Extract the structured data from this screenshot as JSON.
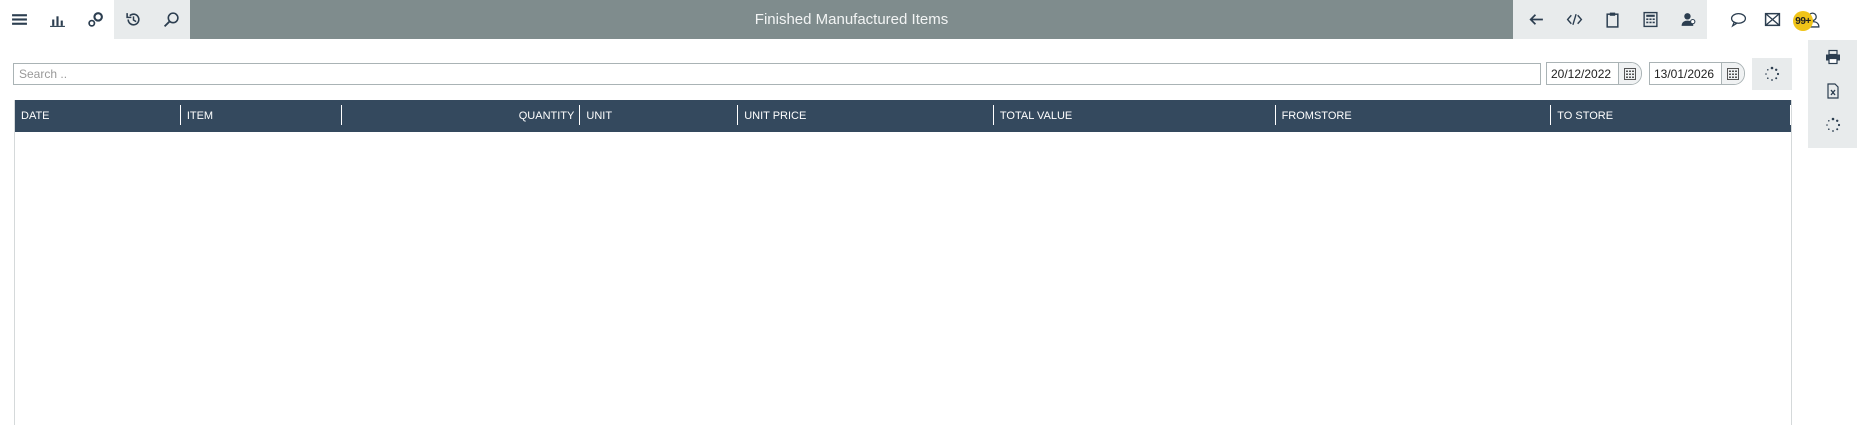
{
  "window": {
    "title": "Finished Manufactured Items"
  },
  "toolbar_left": [
    {
      "name": "menu-icon"
    },
    {
      "name": "bar-chart-icon"
    },
    {
      "name": "gears-icon"
    },
    {
      "name": "history-icon"
    },
    {
      "name": "search-icon"
    }
  ],
  "toolbar_mid": [
    {
      "name": "back-arrow-icon"
    },
    {
      "name": "code-icon"
    },
    {
      "name": "clipboard-icon"
    },
    {
      "name": "calculator-icon"
    },
    {
      "name": "users-icon"
    }
  ],
  "toolbar_right": [
    {
      "name": "chat-icon"
    },
    {
      "name": "mail-icon"
    },
    {
      "name": "user-icon"
    }
  ],
  "notifications": {
    "count": "99+"
  },
  "search": {
    "placeholder": "Search ..",
    "value": ""
  },
  "filters": {
    "date_from": "20/12/2022",
    "date_to": "13/01/2026"
  },
  "table": {
    "columns": [
      "DATE",
      "ITEM",
      "QUANTITY",
      "UNIT",
      "UNIT PRICE",
      "TOTAL VALUE",
      "FROMSTORE",
      "TO STORE"
    ],
    "rows": []
  },
  "side_tools": [
    {
      "name": "print-icon"
    },
    {
      "name": "excel-export-icon"
    },
    {
      "name": "refresh-icon"
    }
  ],
  "colors": {
    "header_bg": "#34495e",
    "title_bar": "#7f8c8d",
    "badge": "#f0c419"
  }
}
